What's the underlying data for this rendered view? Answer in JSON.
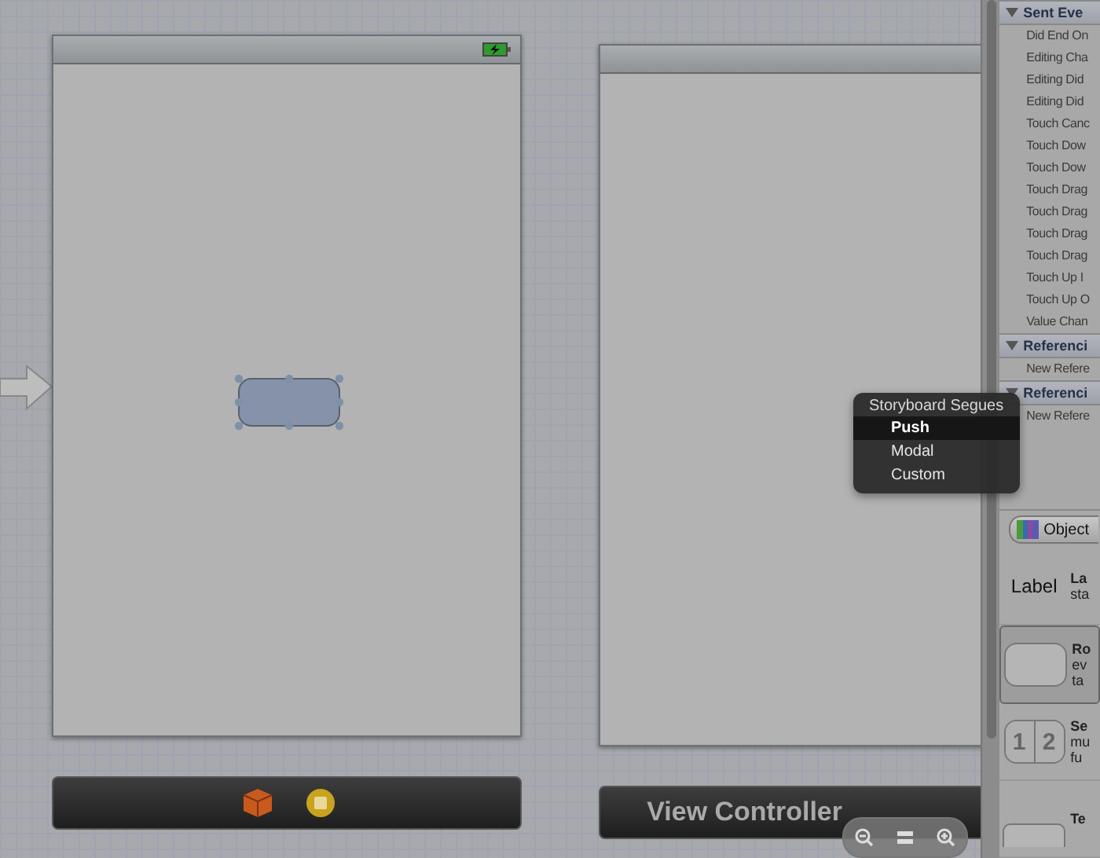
{
  "popup_menu": {
    "title": "Storyboard Segues",
    "items": [
      {
        "label": "Push",
        "selected": true
      },
      {
        "label": "Modal",
        "selected": false
      },
      {
        "label": "Custom",
        "selected": false
      }
    ]
  },
  "right_scene": {
    "dock_title": "View Controller"
  },
  "connections": [
    {
      "header": "Sent Eve",
      "rows": [
        "Did End On",
        "Editing Cha",
        "Editing Did",
        "Editing Did",
        "Touch Canc",
        "Touch Dow",
        "Touch Dow",
        "Touch Drag",
        "Touch Drag",
        "Touch Drag",
        "Touch Drag",
        "Touch Up I",
        "Touch Up O",
        "Value Chan"
      ]
    },
    {
      "header": "Referenci",
      "rows": [
        "New Refere"
      ]
    },
    {
      "header": "Referenci",
      "rows": [
        "New Refere"
      ]
    }
  ],
  "library": {
    "selector": "Object",
    "items": [
      {
        "kind": "label",
        "preview": "Label",
        "lines": [
          "La",
          "sta"
        ],
        "selected": false
      },
      {
        "kind": "round",
        "lines": [
          "Ro",
          "ev",
          "ta"
        ],
        "selected": true
      },
      {
        "kind": "segmented",
        "segments": [
          "1",
          "2"
        ],
        "lines": [
          "Se",
          "mu",
          "fu"
        ],
        "selected": false
      },
      {
        "kind": "field",
        "lines": [
          "Te"
        ],
        "selected": false
      }
    ]
  }
}
